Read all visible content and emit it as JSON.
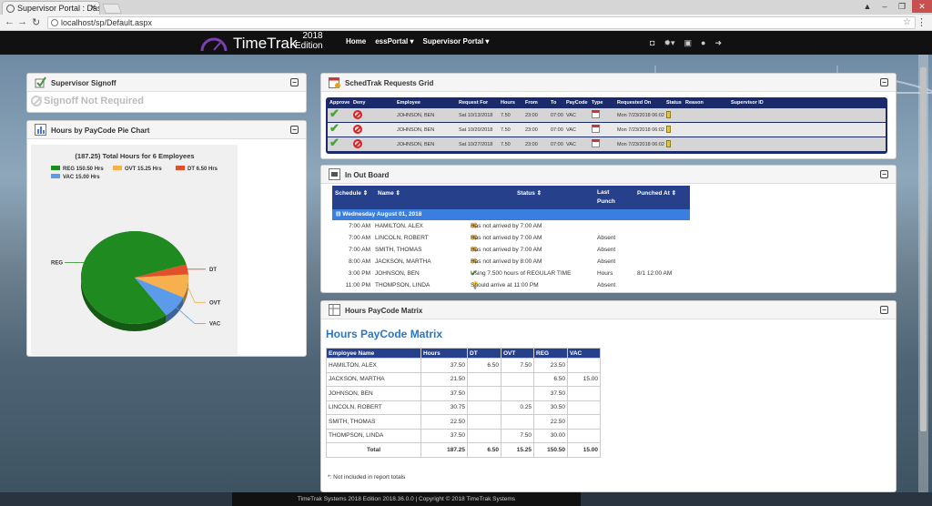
{
  "browser": {
    "tab_title": "Supervisor Portal : Dashb",
    "url": "localhost/sp/Default.aspx"
  },
  "header": {
    "logo": "TimeTrak",
    "edition_year": "2018",
    "edition_label": "Edition",
    "nav": [
      "Home",
      "essPortal ▾",
      "Supervisor Portal ▾"
    ],
    "icons": [
      "camera-icon",
      "gear-icon",
      "cart-icon",
      "user-icon",
      "logout-icon"
    ]
  },
  "signoff": {
    "title": "Supervisor Signoff",
    "status": "Signoff Not Required"
  },
  "pie_panel": {
    "title": "Hours by PayCode Pie Chart"
  },
  "chart_data": {
    "type": "pie",
    "title": "(187.25) Total Hours for 6 Employees",
    "legend": [
      {
        "label": "REG 150.50 Hrs",
        "color": "#1f8a1f"
      },
      {
        "label": "OVT 15.25 Hrs",
        "color": "#f6b04d"
      },
      {
        "label": "DT 6.50 Hrs",
        "color": "#e0502a"
      },
      {
        "label": "VAC 15.00 Hrs",
        "color": "#5b9bea"
      }
    ],
    "slices": [
      {
        "name": "REG",
        "value": 150.5,
        "color": "#1f8a1f"
      },
      {
        "name": "VAC",
        "value": 15.0,
        "color": "#5b9bea"
      },
      {
        "name": "OVT",
        "value": 15.25,
        "color": "#f6b04d"
      },
      {
        "name": "DT",
        "value": 6.5,
        "color": "#e0502a"
      }
    ]
  },
  "sched": {
    "title": "SchedTrak Requests Grid",
    "columns": [
      "Approve",
      "Deny",
      "Employee",
      "Request For",
      "Hours",
      "From",
      "To",
      "PayCode",
      "Type",
      "Requested On",
      "Status",
      "Reason",
      "Supervisor ID"
    ],
    "rows": [
      {
        "employee": "JOHNSON, BEN",
        "date": "Sat 10/13/2018",
        "hours": "7.50",
        "from": "23:00",
        "to": "07:00",
        "paycode": "VAC",
        "requested": "Mon 7/23/2018 06:02"
      },
      {
        "employee": "JOHNSON, BEN",
        "date": "Sat 10/20/2018",
        "hours": "7.50",
        "from": "23:00",
        "to": "07:00",
        "paycode": "VAC",
        "requested": "Mon 7/23/2018 06:02"
      },
      {
        "employee": "JOHNSON, BEN",
        "date": "Sat 10/27/2018",
        "hours": "7.50",
        "from": "23:00",
        "to": "07:00",
        "paycode": "VAC",
        "requested": "Mon 7/23/2018 06:02"
      }
    ]
  },
  "inout": {
    "title": "In Out Board",
    "columns": {
      "schedule": "Schedule ⇕",
      "name": "Name ⇕",
      "status": "Status ⇕",
      "last": "Last",
      "punch": "Punch",
      "punched": "Punched At ⇕"
    },
    "group": "⊟ Wednesday August 01, 2018",
    "rows": [
      {
        "time": "7:00 AM",
        "name": "HAMILTON, ALEX",
        "icon": "x",
        "status": "Has not arrived by 7:00 AM",
        "last": "",
        "at": ""
      },
      {
        "time": "7:00 AM",
        "name": "LINCOLN, ROBERT",
        "icon": "x",
        "status": "Has not arrived by 7:00 AM",
        "last": "Absent",
        "at": ""
      },
      {
        "time": "7:00 AM",
        "name": "SMITH, THOMAS",
        "icon": "x",
        "status": "Has not arrived by 7:00 AM",
        "last": "Absent",
        "at": ""
      },
      {
        "time": "8:00 AM",
        "name": "JACKSON, MARTHA",
        "icon": "x",
        "status": "Has not arrived by 8:00 AM",
        "last": "Absent",
        "at": ""
      },
      {
        "time": "3:00 PM",
        "name": "JOHNSON, BEN",
        "icon": "check",
        "status": "Using 7.500 hours of REGULAR TIME",
        "last": "Hours",
        "at": "8/1 12:00 AM"
      },
      {
        "time": "11:00 PM",
        "name": "THOMPSON, LINDA",
        "icon": "bulb",
        "status": "Should arrive at 11:00 PM",
        "last": "Absent",
        "at": ""
      }
    ]
  },
  "matrix": {
    "panel_title": "Hours PayCode Matrix",
    "heading": "Hours PayCode Matrix",
    "columns": [
      "Employee Name",
      "Hours",
      "DT",
      "OVT",
      "REG",
      "VAC"
    ],
    "rows": [
      [
        "HAMILTON, ALEX",
        "37.50",
        "6.50",
        "7.50",
        "23.50",
        ""
      ],
      [
        "JACKSON, MARTHA",
        "21.50",
        "",
        "",
        "6.50",
        "15.00"
      ],
      [
        "JOHNSON, BEN",
        "37.50",
        "",
        "",
        "37.50",
        ""
      ],
      [
        "LINCOLN, ROBERT",
        "30.75",
        "",
        "0.25",
        "30.50",
        ""
      ],
      [
        "SMITH, THOMAS",
        "22.50",
        "",
        "",
        "22.50",
        ""
      ],
      [
        "THOMPSON, LINDA",
        "37.50",
        "",
        "7.50",
        "30.00",
        ""
      ]
    ],
    "total": [
      "Total",
      "187.25",
      "6.50",
      "15.25",
      "150.50",
      "15.00"
    ],
    "footnote": "*: Not included in report totals"
  },
  "footer": "TimeTrak Systems 2018 Edition 2018.36.0.0   |   Copyright © 2018 TimeTrak Systems"
}
